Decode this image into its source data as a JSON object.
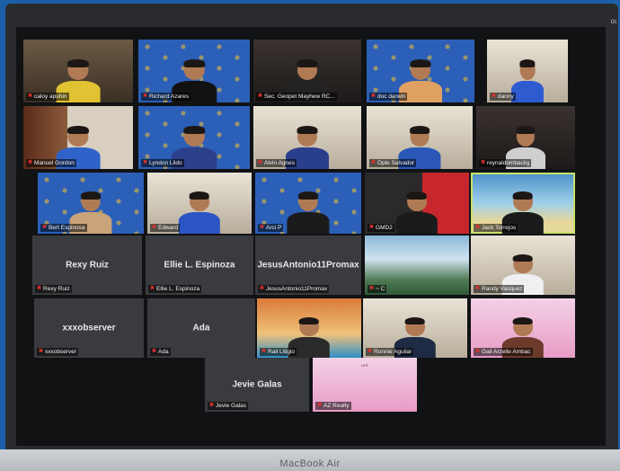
{
  "device": {
    "brand_label": "MacBook Air",
    "top_right_text": "Gt"
  },
  "participants": [
    {
      "name": "caloy apuhin",
      "bg": "bg-room",
      "body": "#e0c232"
    },
    {
      "name": "Richard Azares",
      "bg": "bg-rotary",
      "body": "#111"
    },
    {
      "name": "Sec. Geopet Mayhew RC...",
      "bg": "bg-dark",
      "body": "#222"
    },
    {
      "name": "doc darwin",
      "bg": "bg-rotary",
      "body": "#e0a062"
    },
    {
      "name": "danny",
      "bg": "bg-light",
      "body": "#2f5bd0"
    },
    {
      "name": "Manuel Gordon",
      "bg": "bg-shelf",
      "body": "#2f63c9"
    },
    {
      "name": "Lyndon Llido",
      "bg": "bg-rotary",
      "body": "#2c3f8a"
    },
    {
      "name": "Alvin Agnes",
      "bg": "bg-light",
      "body": "#2a3f8c"
    },
    {
      "name": "Ople Salvador",
      "bg": "bg-light",
      "body": "#2a57b8"
    },
    {
      "name": "reynaldombaclig",
      "bg": "bg-dark",
      "body": "#cfcfcf"
    },
    {
      "name": "Bert Espinosa",
      "bg": "bg-rotary",
      "body": "#c9a37a"
    },
    {
      "name": "Edward",
      "bg": "bg-light",
      "body": "#2b55c2"
    },
    {
      "name": "Arci P",
      "bg": "bg-rotary",
      "body": "#1b1b1b"
    },
    {
      "name": "GMD2",
      "bg": "bg-red",
      "body": "#1b1b1b"
    },
    {
      "name": "Jack Torrejos",
      "bg": "bg-beach",
      "body": "#1b1b1b"
    },
    {
      "name": "Rexy Ruiz",
      "blank": true
    },
    {
      "name": "Ellie L. Espinoza",
      "blank": true
    },
    {
      "name": "JesusAntonio11Promax",
      "blank": true
    },
    {
      "name": "~ C",
      "bg": "bg-mountain",
      "noperson": true
    },
    {
      "name": "Randy Vasquez",
      "bg": "bg-light",
      "body": "#f0f0f0"
    },
    {
      "name": "xxxobserver",
      "blank": true
    },
    {
      "name": "Ada",
      "blank": true
    },
    {
      "name": "Rail Litigio",
      "bg": "bg-church",
      "body": "#2a2a2a"
    },
    {
      "name": "Ronnie Aguilar",
      "bg": "bg-light",
      "body": "#1f2a44"
    },
    {
      "name": "Gail Arzelle Ambac",
      "bg": "bg-pink",
      "body": "#6b3a2a"
    },
    {
      "name": "Jevie Galas",
      "blank": true
    },
    {
      "name": "AZ Realty",
      "bg": "bg-pink",
      "noperson": true,
      "card": "LIFE"
    }
  ]
}
